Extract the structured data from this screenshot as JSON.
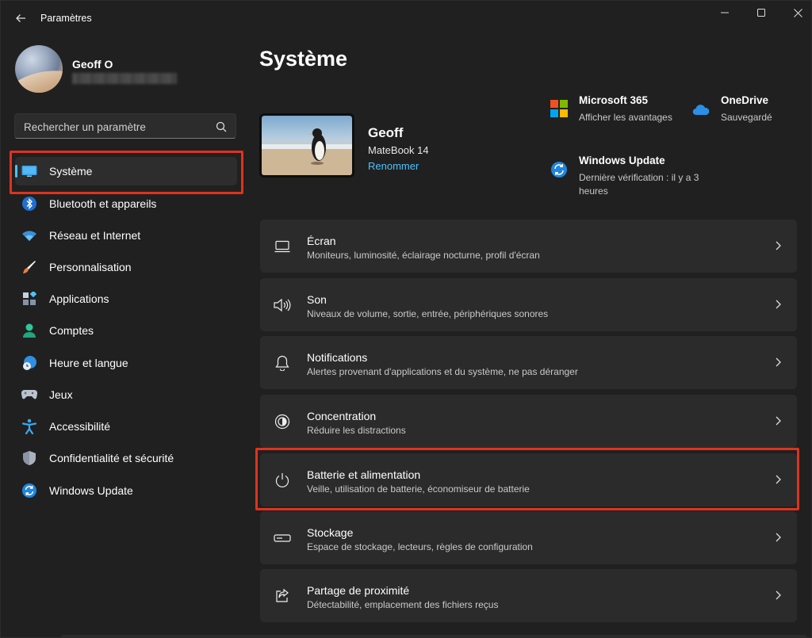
{
  "window": {
    "title": "Paramètres"
  },
  "user": {
    "name": "Geoff O"
  },
  "search": {
    "placeholder": "Rechercher un paramètre"
  },
  "nav": {
    "items": [
      {
        "label": "Système",
        "icon": "system-icon"
      },
      {
        "label": "Bluetooth et appareils",
        "icon": "bluetooth-icon"
      },
      {
        "label": "Réseau et Internet",
        "icon": "wifi-icon"
      },
      {
        "label": "Personnalisation",
        "icon": "brush-icon"
      },
      {
        "label": "Applications",
        "icon": "apps-icon"
      },
      {
        "label": "Comptes",
        "icon": "account-icon"
      },
      {
        "label": "Heure et langue",
        "icon": "clock-globe-icon"
      },
      {
        "label": "Jeux",
        "icon": "gamepad-icon"
      },
      {
        "label": "Accessibilité",
        "icon": "accessibility-icon"
      },
      {
        "label": "Confidentialité et sécurité",
        "icon": "shield-icon"
      },
      {
        "label": "Windows Update",
        "icon": "update-icon"
      }
    ],
    "active_index": 0
  },
  "main": {
    "title": "Système",
    "device": {
      "name": "Geoff",
      "model": "MateBook 14",
      "rename_label": "Renommer"
    },
    "quick": {
      "m365": {
        "title": "Microsoft 365",
        "sub": "Afficher les avantages"
      },
      "onedrive": {
        "title": "OneDrive",
        "sub": "Sauvegardé"
      },
      "winupdate": {
        "title": "Windows Update",
        "sub_line1": "Dernière vérification : il y a 3",
        "sub_line2": "heures"
      }
    },
    "cards": [
      {
        "title": "Écran",
        "sub": "Moniteurs, luminosité, éclairage nocturne, profil d'écran",
        "icon": "monitor-icon"
      },
      {
        "title": "Son",
        "sub": "Niveaux de volume, sortie, entrée, périphériques sonores",
        "icon": "speaker-icon"
      },
      {
        "title": "Notifications",
        "sub": "Alertes provenant d'applications et du système, ne pas déranger",
        "icon": "bell-icon"
      },
      {
        "title": "Concentration",
        "sub": "Réduire les distractions",
        "icon": "focus-icon"
      },
      {
        "title": "Batterie et alimentation",
        "sub": "Veille, utilisation de batterie, économiseur de batterie",
        "icon": "power-icon"
      },
      {
        "title": "Stockage",
        "sub": "Espace de stockage, lecteurs, règles de configuration",
        "icon": "storage-icon"
      },
      {
        "title": "Partage de proximité",
        "sub": "Détectabilité, emplacement des fichiers reçus",
        "icon": "share-icon"
      }
    ]
  },
  "colors": {
    "accent": "#4cc2ff",
    "highlight": "#e0321e",
    "background": "#202020",
    "card": "#2b2b2b"
  }
}
